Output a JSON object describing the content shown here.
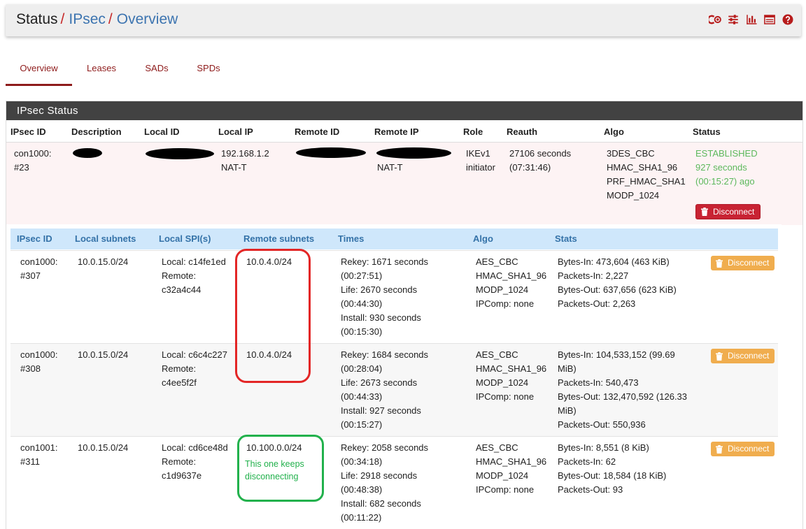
{
  "breadcrumb": {
    "root": "Status",
    "sep": "/",
    "level1": "IPsec",
    "level2": "Overview"
  },
  "header_icons": [
    "co-icon",
    "sliders-icon",
    "bar-chart-icon",
    "list-icon",
    "help-icon"
  ],
  "tabs": [
    {
      "label": "Overview",
      "active": true
    },
    {
      "label": "Leases",
      "active": false
    },
    {
      "label": "SADs",
      "active": false
    },
    {
      "label": "SPDs",
      "active": false
    }
  ],
  "panel": {
    "title": "IPsec Status"
  },
  "phase1": {
    "columns": [
      "IPsec ID",
      "Description",
      "Local ID",
      "Local IP",
      "Remote ID",
      "Remote IP",
      "Role",
      "Reauth",
      "Algo",
      "Status"
    ],
    "row": {
      "id_l1": "con1000:",
      "id_l2": "#23",
      "local_ip_l1": "192.168.1.2",
      "local_ip_l2": "NAT-T",
      "remote_ip_l2": "NAT-T",
      "role_l1": "IKEv1",
      "role_l2": "initiator",
      "reauth_l1": "27106 seconds",
      "reauth_l2": "(07:31:46)",
      "algo": [
        "3DES_CBC",
        "HMAC_SHA1_96",
        "PRF_HMAC_SHA1",
        "MODP_1024"
      ],
      "status_l1": "ESTABLISHED",
      "status_l2": "927 seconds",
      "status_l3": "(00:15:27) ago",
      "disconnect_label": "Disconnect"
    }
  },
  "phase2": {
    "columns": [
      "IPsec ID",
      "Local subnets",
      "Local SPI(s)",
      "Remote subnets",
      "Times",
      "Algo",
      "Stats"
    ],
    "rows": [
      {
        "id_l1": "con1000:",
        "id_l2": "#307",
        "local_subnet": "10.0.15.0/24",
        "spi_l1": "Local: c14fe1ed",
        "spi_l2": "Remote:",
        "spi_l3": "c32a4c44",
        "remote_subnet": "10.0.4.0/24",
        "times": [
          "Rekey: 1671 seconds",
          "(00:27:51)",
          "Life: 2670 seconds",
          "(00:44:30)",
          "Install: 930 seconds",
          "(00:15:30)"
        ],
        "algo": [
          "AES_CBC",
          "HMAC_SHA1_96",
          "MODP_1024",
          "IPComp: none"
        ],
        "stats": [
          "Bytes-In: 473,604 (463 KiB)",
          "Packets-In: 2,227",
          "Bytes-Out: 637,656 (623 KiB)",
          "Packets-Out: 2,263"
        ],
        "disconnect_label": "Disconnect"
      },
      {
        "id_l1": "con1000:",
        "id_l2": "#308",
        "local_subnet": "10.0.15.0/24",
        "spi_l1": "Local: c6c4c227",
        "spi_l2": "Remote:",
        "spi_l3": "c4ee5f2f",
        "remote_subnet": "10.0.4.0/24",
        "times": [
          "Rekey: 1684 seconds",
          "(00:28:04)",
          "Life: 2673 seconds",
          "(00:44:33)",
          "Install: 927 seconds",
          "(00:15:27)"
        ],
        "algo": [
          "AES_CBC",
          "HMAC_SHA1_96",
          "MODP_1024",
          "IPComp: none"
        ],
        "stats": [
          "Bytes-In: 104,533,152 (99.69",
          "MiB)",
          "Packets-In: 540,473",
          "Bytes-Out: 132,470,592 (126.33",
          "MiB)",
          "Packets-Out: 550,936"
        ],
        "disconnect_label": "Disconnect"
      },
      {
        "id_l1": "con1001:",
        "id_l2": "#311",
        "local_subnet": "10.0.15.0/24",
        "spi_l1": "Local: cd6ce48d",
        "spi_l2": "Remote:",
        "spi_l3": "c1d9637e",
        "remote_subnet": "10.100.0.0/24",
        "times": [
          "Rekey: 2058 seconds",
          "(00:34:18)",
          "Life: 2918 seconds",
          "(00:48:38)",
          "Install: 682 seconds",
          "(00:11:22)"
        ],
        "algo": [
          "AES_CBC",
          "HMAC_SHA1_96",
          "MODP_1024",
          "IPComp: none"
        ],
        "stats": [
          "Bytes-In: 8,551 (8 KiB)",
          "Packets-In: 62",
          "Bytes-Out: 18,584 (18 KiB)",
          "Packets-Out: 93"
        ],
        "disconnect_label": "Disconnect"
      }
    ]
  },
  "annotation": {
    "line1": "This one keeps",
    "line2": "disconnecting"
  },
  "colors": {
    "accent": "#8e1b1b",
    "established": "#5cb85c",
    "child_header": "#cfe7fb",
    "annotation_red": "#e32626",
    "annotation_green": "#22b14c"
  }
}
